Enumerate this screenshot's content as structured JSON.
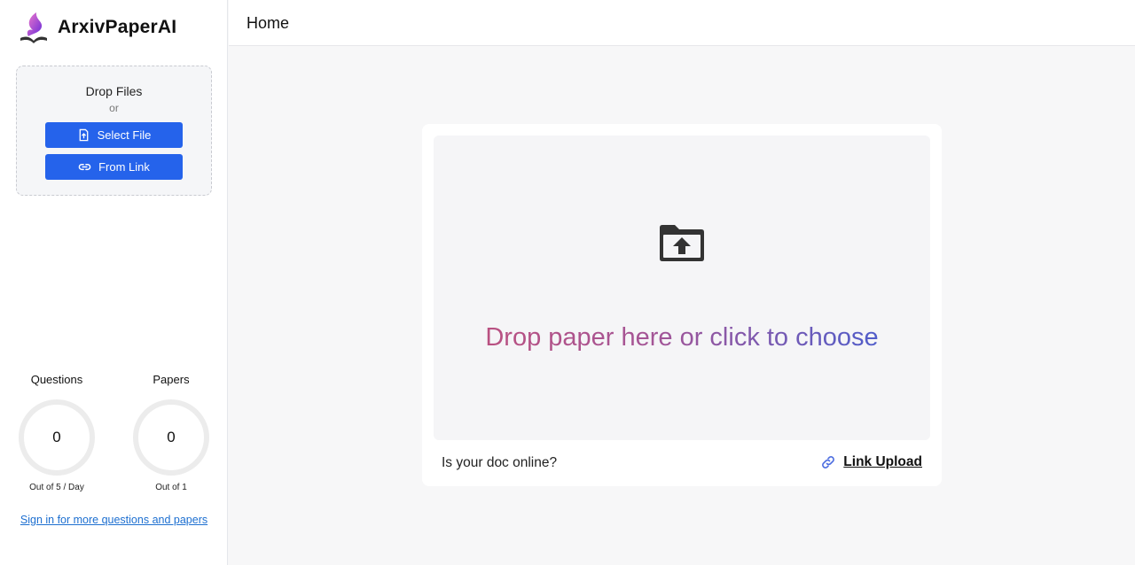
{
  "app": {
    "name": "ArxivPaperAI"
  },
  "header": {
    "title": "Home"
  },
  "sidebar": {
    "dropbox": {
      "title": "Drop Files",
      "or": "or",
      "select_file": "Select File",
      "from_link": "From Link"
    },
    "stats": {
      "questions": {
        "label": "Questions",
        "value": "0",
        "sub": "Out of 5 / Day"
      },
      "papers": {
        "label": "Papers",
        "value": "0",
        "sub": "Out of 1"
      }
    },
    "signin": "Sign in for more questions and papers"
  },
  "main": {
    "drop_prompt": "Drop paper here or click to choose",
    "online_question": "Is your doc online?",
    "link_upload": "Link Upload"
  },
  "colors": {
    "primary_button": "#2563eb",
    "link": "#1d6fd0",
    "gradient_start": "#c04f7a",
    "gradient_end": "#3d5fd6"
  },
  "icons": [
    "logo-icon",
    "file-upload-icon",
    "link-icon",
    "folder-upload-icon",
    "link-upload-icon"
  ]
}
